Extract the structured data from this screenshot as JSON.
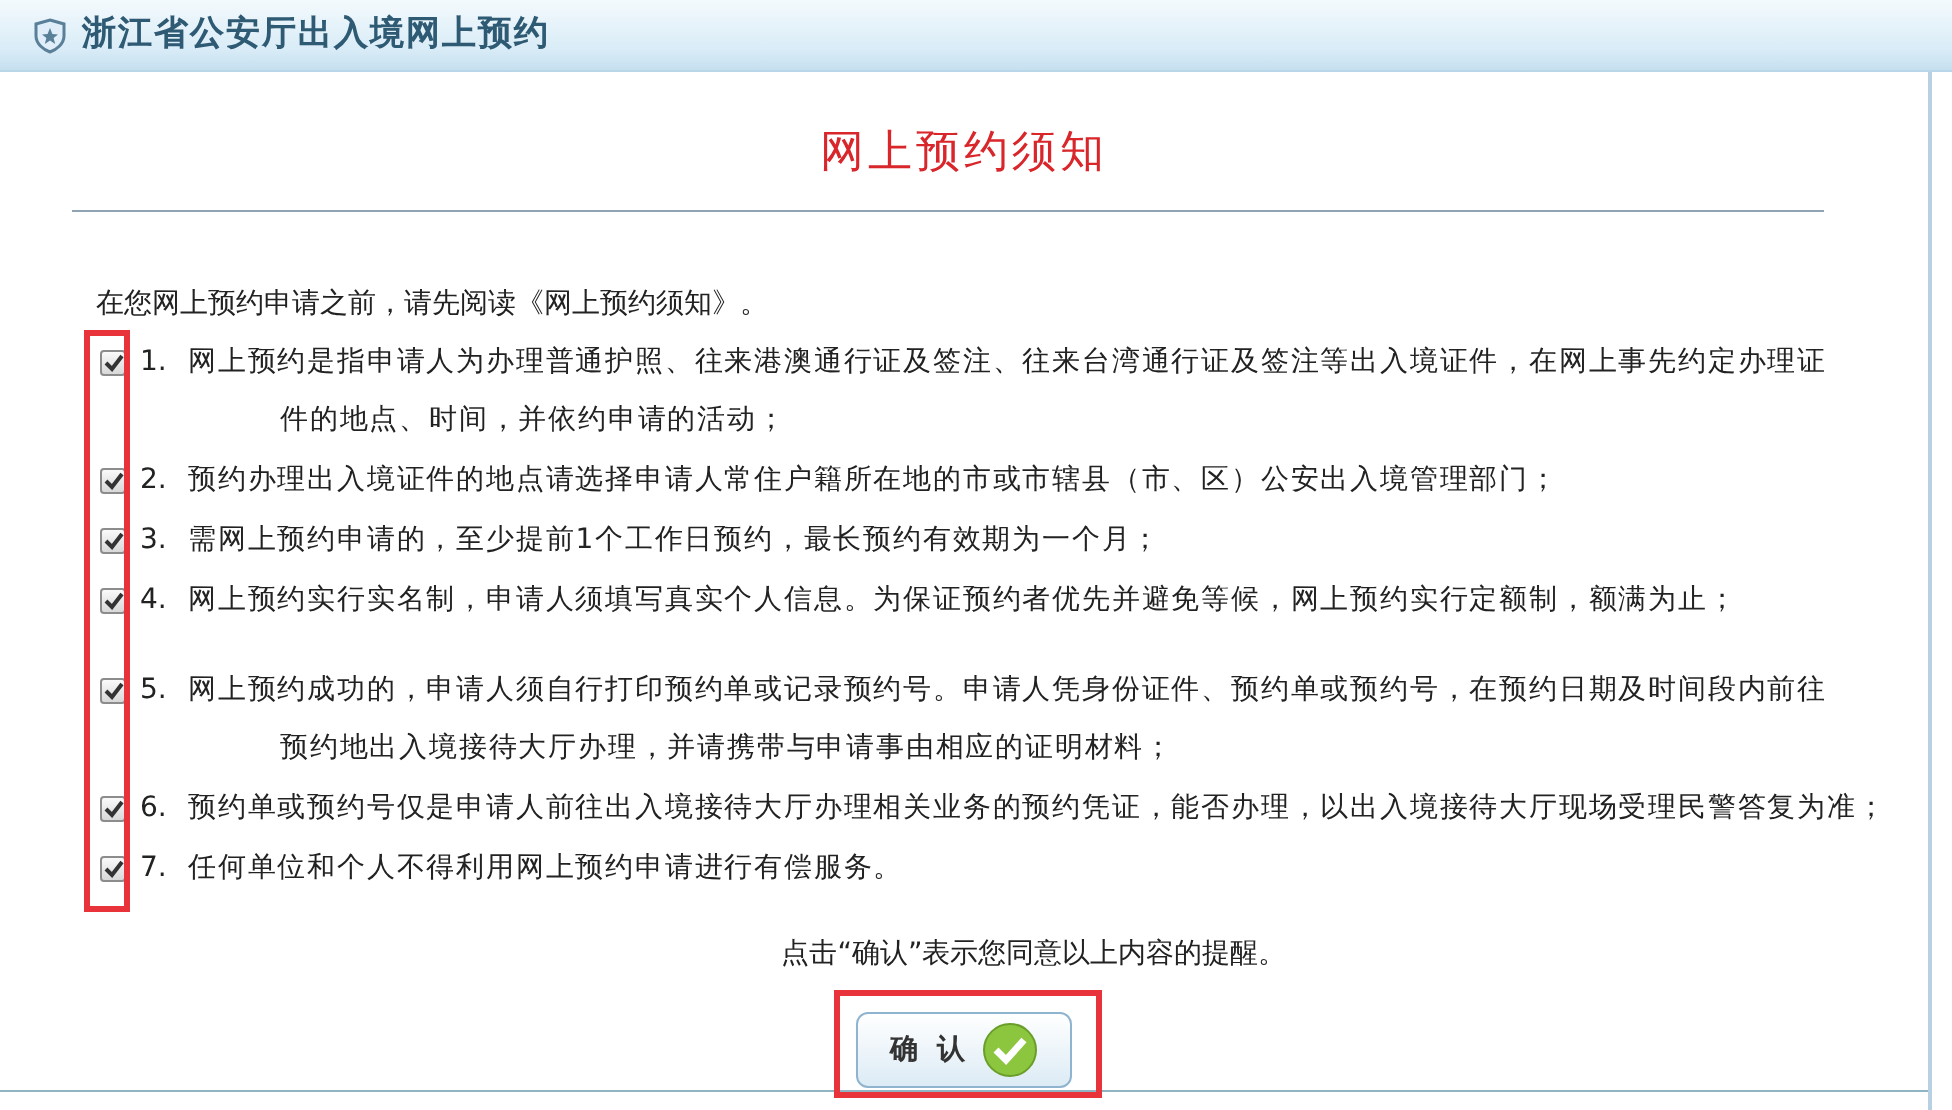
{
  "header": {
    "title": "浙江省公安厅出入境网上预约"
  },
  "heading": "网上预约须知",
  "intro": "在您网上预约申请之前，请先阅读《网上预约须知》。",
  "items": [
    {
      "number": "1.",
      "checked": true,
      "lines": [
        "网上预约是指申请人为办理普通护照、往来港澳通行证及签注、往来台湾通行证及签注等出入境证件，在网上事先约定办理证",
        "件的地点、时间，并依约申请的活动；"
      ]
    },
    {
      "number": "2.",
      "checked": true,
      "lines": [
        "预约办理出入境证件的地点请选择申请人常住户籍所在地的市或市辖县（市、区）公安出入境管理部门；"
      ]
    },
    {
      "number": "3.",
      "checked": true,
      "lines": [
        "需网上预约申请的，至少提前1个工作日预约，最长预约有效期为一个月；"
      ]
    },
    {
      "number": "4.",
      "checked": true,
      "lines": [
        "网上预约实行实名制，申请人须填写真实个人信息。为保证预约者优先并避免等候，网上预约实行定额制，额满为止；"
      ]
    },
    {
      "number": "5.",
      "checked": true,
      "lines": [
        "网上预约成功的，申请人须自行打印预约单或记录预约号。申请人凭身份证件、预约单或预约号，在预约日期及时间段内前往",
        "预约地出入境接待大厅办理，并请携带与申请事由相应的证明材料；"
      ]
    },
    {
      "number": "6.",
      "checked": true,
      "lines": [
        "预约单或预约号仅是申请人前往出入境接待大厅办理相关业务的预约凭证，能否办理，以出入境接待大厅现场受理民警答复为准；"
      ]
    },
    {
      "number": "7.",
      "checked": true,
      "lines": [
        "任何单位和个人不得利用网上预约申请进行有偿服务。"
      ]
    }
  ],
  "note": "点击“确认”表示您同意以上内容的提醒。",
  "confirm_button": "确  认"
}
